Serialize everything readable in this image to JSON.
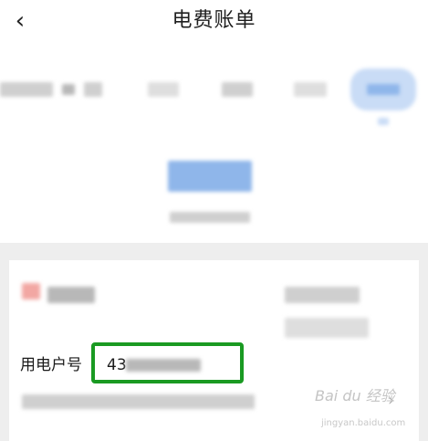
{
  "nav": {
    "title": "电费账单",
    "back_icon": "chevron-left-icon"
  },
  "account": {
    "label": "用电户号",
    "value_prefix": "43"
  },
  "highlight_color": "#1a9a22",
  "watermark": {
    "text": "Bai du 经验",
    "sub": "jingyan.baidu.com"
  }
}
